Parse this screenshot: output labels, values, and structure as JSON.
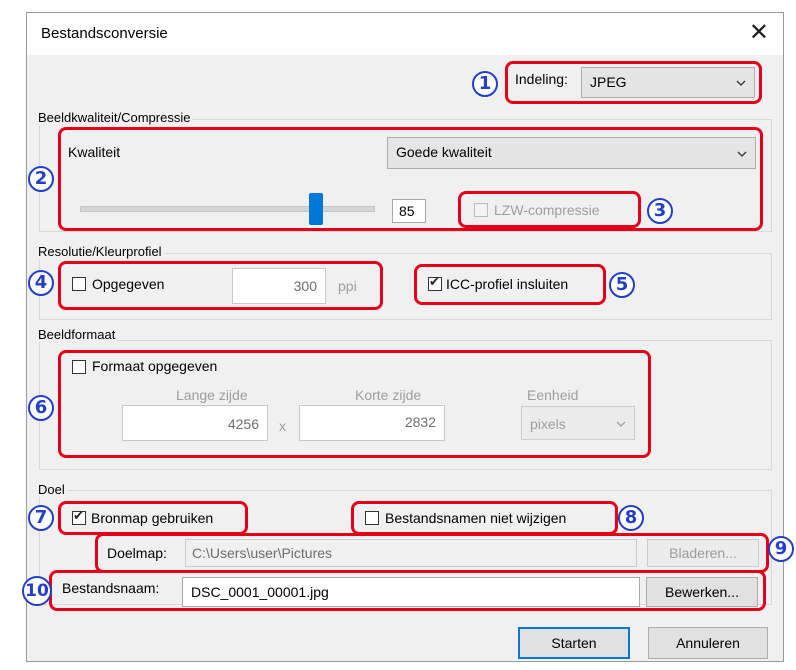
{
  "window": {
    "title": "Bestandsconversie",
    "close_glyph": "✕"
  },
  "format": {
    "label": "Indeling:",
    "value": "JPEG"
  },
  "quality_group": {
    "label": "Beeldkwaliteit/Compressie",
    "quality_label": "Kwaliteit",
    "quality_value": "Goede kwaliteit",
    "slider_value": "85",
    "lzw_label": "LZW-compressie"
  },
  "resolution_group": {
    "label": "Resolutie/Kleurprofiel",
    "specified_label": "Opgegeven",
    "resolution_value": "300",
    "unit": "ppi",
    "icc_label": "ICC-profiel insluiten"
  },
  "size_group": {
    "label": "Beeldformaat",
    "specify_label": "Formaat opgegeven",
    "long_side_label": "Lange zijde",
    "long_side_value": "4256",
    "times": "x",
    "short_side_label": "Korte zijde",
    "short_side_value": "2832",
    "unit_label": "Eenheid",
    "unit_value": "pixels"
  },
  "destination_group": {
    "label": "Doel",
    "use_source_label": "Bronmap gebruiken",
    "keep_names_label": "Bestandsnamen niet wijzigen",
    "folder_label": "Doelmap:",
    "folder_value": "C:\\Users\\user\\Pictures",
    "browse_label": "Bladeren...",
    "filename_label": "Bestandsnaam:",
    "filename_value": "DSC_0001_00001.jpg",
    "edit_label": "Bewerken..."
  },
  "buttons": {
    "start": "Starten",
    "cancel": "Annuleren"
  },
  "callouts": [
    "1",
    "2",
    "3",
    "4",
    "5",
    "6",
    "7",
    "8",
    "9",
    "10"
  ],
  "state": {
    "slider_level_percent": 82,
    "icc_checked": true,
    "use_source_checked": true,
    "specified_checked": false,
    "size_checked": false,
    "keep_names_checked": false
  },
  "colors": {
    "callout_border": "#e4001b",
    "badge": "#233fc8",
    "slider_thumb": "#0078d7",
    "primary_border": "#0078d7"
  }
}
